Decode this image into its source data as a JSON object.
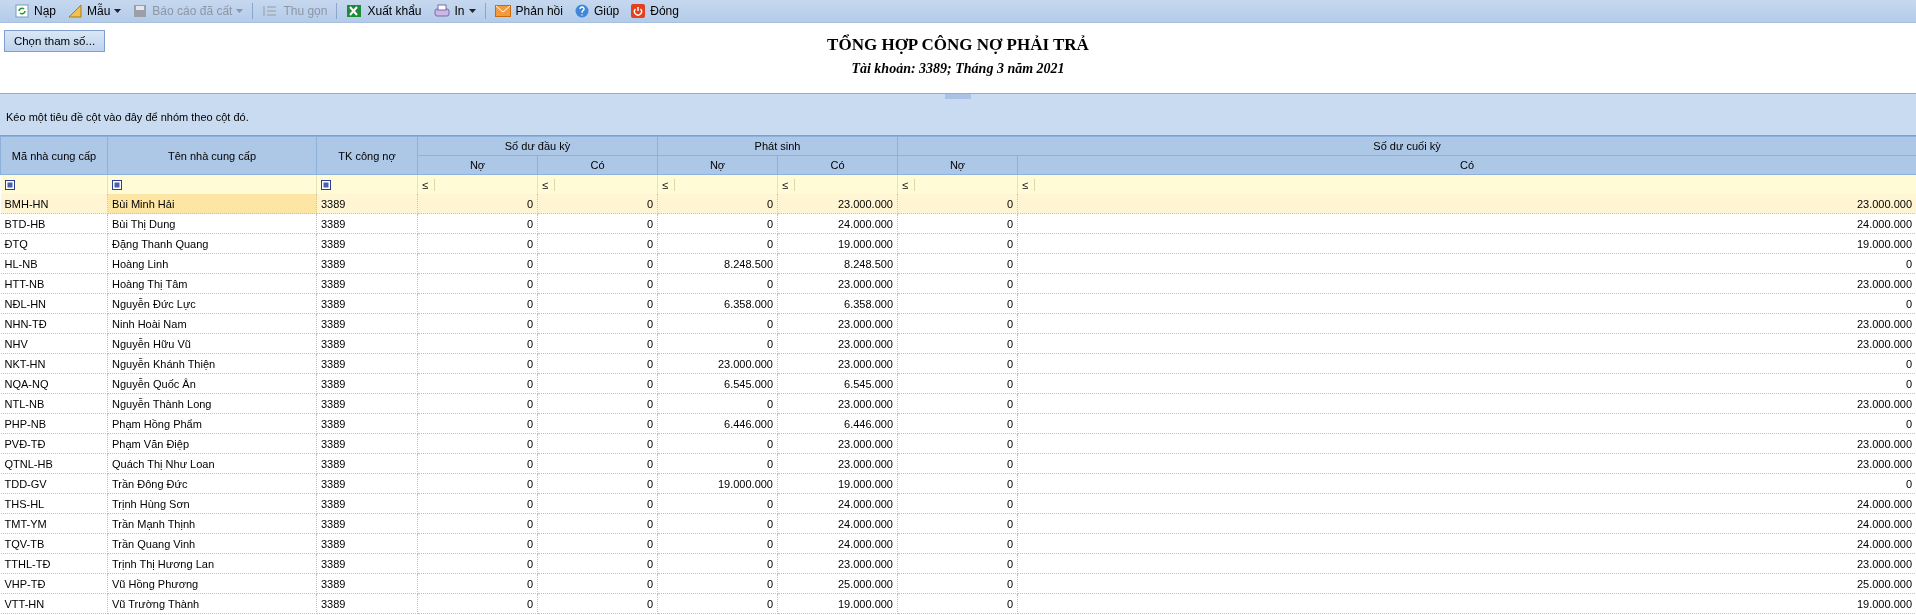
{
  "toolbar": [
    {
      "kind": "button",
      "label": "Nạp",
      "disabled": false
    },
    {
      "kind": "dropdown",
      "label": "Mẫu",
      "disabled": false
    },
    {
      "kind": "dropdown",
      "label": "Báo cáo đã cất",
      "disabled": true
    },
    {
      "kind": "separator"
    },
    {
      "kind": "button",
      "label": "Thu gọn",
      "disabled": true
    },
    {
      "kind": "separator"
    },
    {
      "kind": "button",
      "label": "Xuất khẩu",
      "disabled": false
    },
    {
      "kind": "dropdown",
      "label": "In",
      "disabled": false
    },
    {
      "kind": "separator"
    },
    {
      "kind": "button",
      "label": "Phản hồi",
      "disabled": false
    },
    {
      "kind": "button",
      "label": "Giúp",
      "disabled": false
    },
    {
      "kind": "button",
      "label": "Đóng",
      "disabled": false
    }
  ],
  "params_button": "Chọn tham số...",
  "report": {
    "title": "TỔNG HỢP CÔNG NỢ PHẢI TRẢ",
    "subtitle": "Tài khoản: 3389; Tháng 3 năm 2021"
  },
  "group_panel": "Kéo một tiêu đề cột vào đây để nhóm theo cột đó.",
  "table": {
    "column_groups": [
      {
        "label": "Số dư đầu kỳ"
      },
      {
        "label": "Phát sinh"
      },
      {
        "label": "Số dư cuối kỳ"
      }
    ],
    "columns": [
      {
        "label": "Mã nhà cung cấp"
      },
      {
        "label": "Tên nhà cung cấp"
      },
      {
        "label": "TK công nợ"
      },
      {
        "label": "Nợ"
      },
      {
        "label": "Có"
      },
      {
        "label": "Nợ"
      },
      {
        "label": "Có"
      },
      {
        "label": "Nợ"
      },
      {
        "label": "Có"
      }
    ],
    "filters": [
      {
        "kind": "checkbox"
      },
      {
        "kind": "checkbox"
      },
      {
        "kind": "checkbox"
      },
      {
        "kind": "operator",
        "text": "≤"
      },
      {
        "kind": "operator",
        "text": "≤"
      },
      {
        "kind": "operator",
        "text": "≤"
      },
      {
        "kind": "operator",
        "text": "≤"
      },
      {
        "kind": "operator",
        "text": "≤"
      },
      {
        "kind": "operator",
        "text": "≤"
      }
    ],
    "rows": [
      {
        "selected": true,
        "cells": [
          "BMH-HN",
          "Bùi Minh Hải",
          "3389",
          "0",
          "0",
          "0",
          "23.000.000",
          "0",
          "23.000.000"
        ]
      },
      {
        "selected": false,
        "cells": [
          "BTD-HB",
          "Bùi Thị Dung",
          "3389",
          "0",
          "0",
          "0",
          "24.000.000",
          "0",
          "24.000.000"
        ]
      },
      {
        "selected": false,
        "cells": [
          "ĐTQ",
          "Đặng Thanh Quang",
          "3389",
          "0",
          "0",
          "0",
          "19.000.000",
          "0",
          "19.000.000"
        ]
      },
      {
        "selected": false,
        "cells": [
          "HL-NB",
          "Hoàng Linh",
          "3389",
          "0",
          "0",
          "8.248.500",
          "8.248.500",
          "0",
          "0"
        ]
      },
      {
        "selected": false,
        "cells": [
          "HTT-NB",
          "Hoàng Thị Tâm",
          "3389",
          "0",
          "0",
          "0",
          "23.000.000",
          "0",
          "23.000.000"
        ]
      },
      {
        "selected": false,
        "cells": [
          "NĐL-HN",
          "Nguyễn Đức Lực",
          "3389",
          "0",
          "0",
          "6.358.000",
          "6.358.000",
          "0",
          "0"
        ]
      },
      {
        "selected": false,
        "cells": [
          "NHN-TĐ",
          "Ninh Hoài Nam",
          "3389",
          "0",
          "0",
          "0",
          "23.000.000",
          "0",
          "23.000.000"
        ]
      },
      {
        "selected": false,
        "cells": [
          "NHV",
          "Nguyễn Hữu Vũ",
          "3389",
          "0",
          "0",
          "0",
          "23.000.000",
          "0",
          "23.000.000"
        ]
      },
      {
        "selected": false,
        "cells": [
          "NKT-HN",
          "Nguyễn Khánh Thiện",
          "3389",
          "0",
          "0",
          "23.000.000",
          "23.000.000",
          "0",
          "0"
        ]
      },
      {
        "selected": false,
        "cells": [
          "NQA-NQ",
          "Nguyễn Quốc Ân",
          "3389",
          "0",
          "0",
          "6.545.000",
          "6.545.000",
          "0",
          "0"
        ]
      },
      {
        "selected": false,
        "cells": [
          "NTL-NB",
          "Nguyễn Thành Long",
          "3389",
          "0",
          "0",
          "0",
          "23.000.000",
          "0",
          "23.000.000"
        ]
      },
      {
        "selected": false,
        "cells": [
          "PHP-NB",
          "Phạm Hồng Phẩm",
          "3389",
          "0",
          "0",
          "6.446.000",
          "6.446.000",
          "0",
          "0"
        ]
      },
      {
        "selected": false,
        "cells": [
          "PVĐ-TĐ",
          "Phạm Văn Điệp",
          "3389",
          "0",
          "0",
          "0",
          "23.000.000",
          "0",
          "23.000.000"
        ]
      },
      {
        "selected": false,
        "cells": [
          "QTNL-HB",
          "Quách Thị Như Loan",
          "3389",
          "0",
          "0",
          "0",
          "23.000.000",
          "0",
          "23.000.000"
        ]
      },
      {
        "selected": false,
        "cells": [
          "TDD-GV",
          "Trần Đông Đức",
          "3389",
          "0",
          "0",
          "19.000.000",
          "19.000.000",
          "0",
          "0"
        ]
      },
      {
        "selected": false,
        "cells": [
          "THS-HL",
          "Trịnh Hùng Sơn",
          "3389",
          "0",
          "0",
          "0",
          "24.000.000",
          "0",
          "24.000.000"
        ]
      },
      {
        "selected": false,
        "cells": [
          "TMT-YM",
          "Trần Mạnh Thịnh",
          "3389",
          "0",
          "0",
          "0",
          "24.000.000",
          "0",
          "24.000.000"
        ]
      },
      {
        "selected": false,
        "cells": [
          "TQV-TB",
          "Trần Quang Vinh",
          "3389",
          "0",
          "0",
          "0",
          "24.000.000",
          "0",
          "24.000.000"
        ]
      },
      {
        "selected": false,
        "cells": [
          "TTHL-TĐ",
          "Trịnh Thị Hương Lan",
          "3389",
          "0",
          "0",
          "0",
          "23.000.000",
          "0",
          "23.000.000"
        ]
      },
      {
        "selected": false,
        "cells": [
          "VHP-TĐ",
          "Vũ Hồng Phương",
          "3389",
          "0",
          "0",
          "0",
          "25.000.000",
          "0",
          "25.000.000"
        ]
      },
      {
        "selected": false,
        "cells": [
          "VTT-HN",
          "Vũ Trường Thành",
          "3389",
          "0",
          "0",
          "0",
          "19.000.000",
          "0",
          "19.000.000"
        ]
      }
    ]
  }
}
